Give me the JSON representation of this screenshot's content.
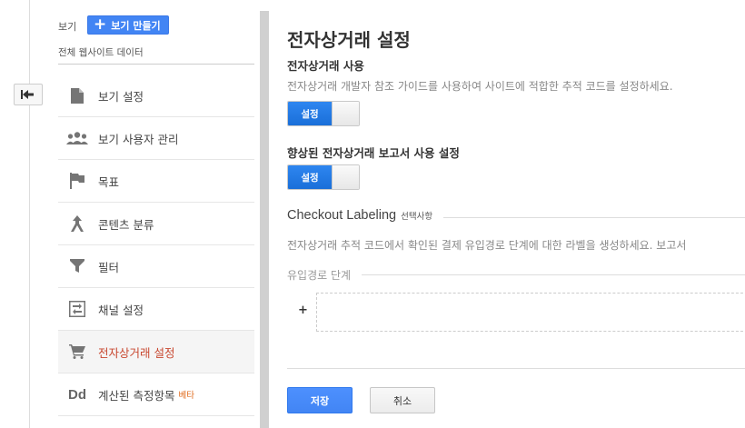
{
  "sidebar": {
    "view_label": "보기",
    "create_view_label": "보기 만들기",
    "view_name": "전체 웹사이트 데이터",
    "items": [
      {
        "label": "보기 설정",
        "icon": "document-icon"
      },
      {
        "label": "보기 사용자 관리",
        "icon": "users-icon"
      },
      {
        "label": "목표",
        "icon": "flag-icon"
      },
      {
        "label": "콘텐츠 분류",
        "icon": "content-grouping-icon"
      },
      {
        "label": "필터",
        "icon": "filter-icon"
      },
      {
        "label": "채널 설정",
        "icon": "channel-settings-icon"
      },
      {
        "label": "전자상거래 설정",
        "icon": "cart-icon",
        "active": true
      },
      {
        "label": "계산된 측정항목",
        "icon": "dd-icon",
        "badge": "베타",
        "icon_text": "Dd"
      }
    ]
  },
  "main": {
    "title": "전자상거래 설정",
    "ecommerce": {
      "title": "전자상거래 사용",
      "description": "전자상거래 개발자 참조 가이드를 사용하여 사이트에 적합한 추적 코드를 설정하세요.",
      "toggle_label": "설정"
    },
    "enhanced": {
      "title": "향상된 전자상거래 보고서 사용 설정",
      "toggle_label": "설정"
    },
    "checkout": {
      "title": "Checkout Labeling",
      "optional": "선택사항",
      "description": "전자상거래 추적 코드에서 확인된 결제 유입경로 단계에 대한 라벨을 생성하세요. 보고서",
      "funnel_title": "유입경로 단계",
      "add_label": "+"
    },
    "buttons": {
      "save": "저장",
      "cancel": "취소"
    }
  },
  "colors": {
    "accent": "#4285f4",
    "active_text": "#c8472f",
    "beta": "#e06a1b"
  }
}
